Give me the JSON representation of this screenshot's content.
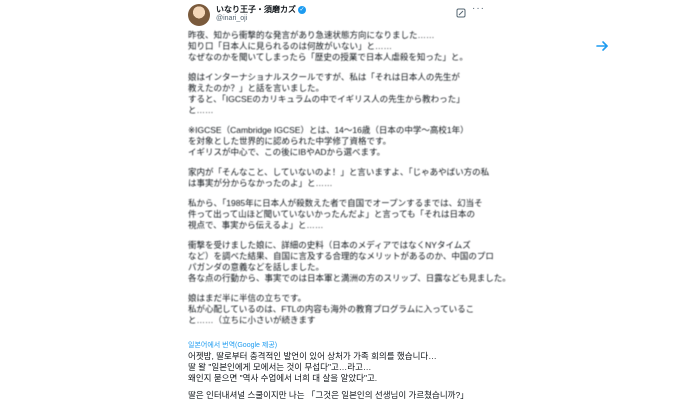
{
  "tweet": {
    "author_name": "いなり王子・須磨カズ",
    "handle": "@inari_oji",
    "paragraphs": [
      [
        "昨夜、知から衝撃的な発言があり急速状態方向になりました……",
        "知り口「日本人に見られるのは何故がいない」と……",
        "なぜなのかを聞いてしまったら「歴史の授業で日本人虐殺を知った」と。"
      ],
      [
        "娘はインターナショナルスクールですが、私は「それは日本人の先生が",
        "教えたのか？」と話を言いました。",
        "すると、「IGCSEのカリキュラムの中でイギリス人の先生から教わった」",
        "と……"
      ],
      [
        "※IGCSE（Cambridge IGCSE）とは、14〜16歳（日本の中学〜高校1年）",
        "を対象とした世界的に認められた中学修了資格です。",
        "イギリスが中心で、この後にIBやADから選べます。"
      ],
      [
        "家内が「そんなこと、していないのよ！」と言いますよ、「じゃあやばい方の私",
        "は事実が分からなかったのよ」と……"
      ],
      [
        "私から、「1985年に日本人が殺数えた者で自国でオープンするまでは、幻当そ",
        "件って出って山ほど聞いていないかったんだよ」と言っても「それは日本の",
        "視点で、事実から伝えるよ」と……"
      ],
      [
        "衝撃を受けました娘に、詳細の史料（日本のメディアではなくNYタイムズ",
        "など）を調べた結果、自国に言及する合理的なメリットがあるのか、中国のプロ",
        "パガンダの意義などを話しました。",
        "各な点の行動から、事実でのは日本軍と満洲の方のスリップ、日露なども見ました。"
      ],
      [
        "娘はまだ半に半信の立ちです。",
        "私が心配しているのは、FTLの内容も海外の教育プログラムに入っているこ",
        "と……（立ちに小さいが続きます"
      ]
    ],
    "translate_label": "일본어에서 번역(Google 제공)",
    "translation": [
      [
        "어젯밤, 딸로부터 충격적인 발언이 있어 상처가 가족 회의를 했습니다…",
        "딸 왈 \"일본인에게 모에서는 것이 무섭다\"고…라고…",
        "왜인지 묻으면 \"역사 수업에서 너희 대 살을 알았다\"고."
      ],
      [
        "딸은 인터내셔널 스쿨이지만 나는 「그것은 일본인의 선생님이 가르쳤습니까?」"
      ]
    ]
  },
  "colors": {
    "link": "#1d9bf0",
    "text": "#0f1419",
    "muted": "#536471"
  },
  "icons": {
    "verified": "verified-badge-icon",
    "more": "more-options-icon",
    "next": "arrow-right-icon"
  }
}
